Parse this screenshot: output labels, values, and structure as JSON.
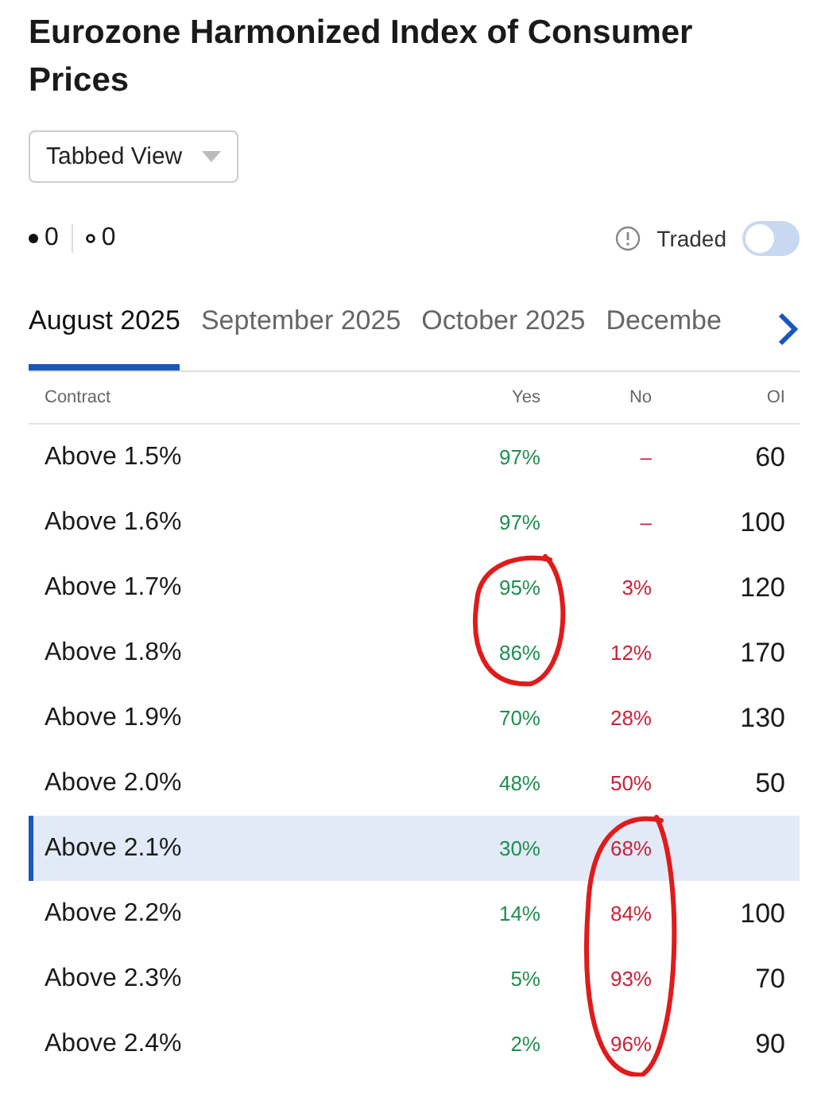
{
  "title": "Eurozone Harmonized Index of Consumer Prices",
  "view_select": {
    "value": "Tabbed View"
  },
  "counts": [
    {
      "kind": "filled",
      "value": "0"
    },
    {
      "kind": "hollow",
      "value": "0"
    }
  ],
  "traded": {
    "label": "Traded",
    "on": false
  },
  "tabs": [
    {
      "label": "August 2025",
      "selected": true
    },
    {
      "label": "September 2025",
      "selected": false
    },
    {
      "label": "October 2025",
      "selected": false
    },
    {
      "label": "Decembe",
      "selected": false
    }
  ],
  "table": {
    "columns": [
      "Contract",
      "Yes",
      "No",
      "OI"
    ],
    "rows": [
      {
        "contract": "Above 1.5%",
        "yes": "97%",
        "no": "–",
        "oi": "60",
        "selected": false,
        "yes_circled": false,
        "no_circled": false
      },
      {
        "contract": "Above 1.6%",
        "yes": "97%",
        "no": "–",
        "oi": "100",
        "selected": false,
        "yes_circled": false,
        "no_circled": false
      },
      {
        "contract": "Above 1.7%",
        "yes": "95%",
        "no": "3%",
        "oi": "120",
        "selected": false,
        "yes_circled": true,
        "no_circled": false
      },
      {
        "contract": "Above 1.8%",
        "yes": "86%",
        "no": "12%",
        "oi": "170",
        "selected": false,
        "yes_circled": true,
        "no_circled": false
      },
      {
        "contract": "Above 1.9%",
        "yes": "70%",
        "no": "28%",
        "oi": "130",
        "selected": false,
        "yes_circled": false,
        "no_circled": false
      },
      {
        "contract": "Above 2.0%",
        "yes": "48%",
        "no": "50%",
        "oi": "50",
        "selected": false,
        "yes_circled": false,
        "no_circled": false
      },
      {
        "contract": "Above 2.1%",
        "yes": "30%",
        "no": "68%",
        "selected": true,
        "yes_circled": false,
        "no_circled": true
      },
      {
        "contract": "Above 2.2%",
        "yes": "14%",
        "no": "84%",
        "oi": "100",
        "selected": false,
        "yes_circled": false,
        "no_circled": true
      },
      {
        "contract": "Above 2.3%",
        "yes": "5%",
        "no": "93%",
        "oi": "70",
        "selected": false,
        "yes_circled": false,
        "no_circled": true
      },
      {
        "contract": "Above 2.4%",
        "yes": "2%",
        "no": "96%",
        "oi": "90",
        "selected": false,
        "yes_circled": false,
        "no_circled": true
      }
    ]
  }
}
